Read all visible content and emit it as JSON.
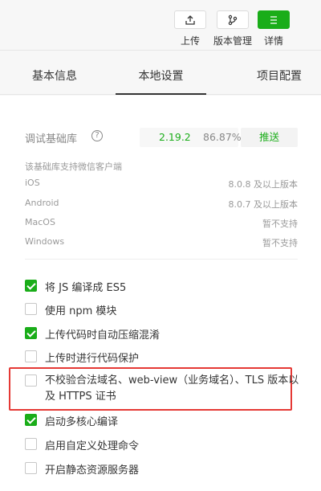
{
  "toolbar": {
    "upload_label": "上传",
    "version_label": "版本管理",
    "detail_label": "详情"
  },
  "tabs": [
    {
      "label": "基本信息"
    },
    {
      "label": "本地设置"
    },
    {
      "label": "项目配置"
    }
  ],
  "library": {
    "label": "调试基础库",
    "help": "?",
    "version": "2.19.2",
    "percent": "86.87%",
    "push_label": "推送"
  },
  "support": {
    "title": "该基础库支持微信客户端",
    "rows": [
      {
        "os": "iOS",
        "req": "8.0.8 及以上版本"
      },
      {
        "os": "Android",
        "req": "8.0.7 及以上版本"
      },
      {
        "os": "MacOS",
        "req": "暂不支持"
      },
      {
        "os": "Windows",
        "req": "暂不支持"
      }
    ]
  },
  "options": [
    {
      "label": "将 JS 编译成 ES5",
      "checked": true
    },
    {
      "label": "使用 npm 模块",
      "checked": false
    },
    {
      "label": "上传代码时自动压缩混淆",
      "checked": true
    },
    {
      "label": "上传时进行代码保护",
      "checked": false
    },
    {
      "label": "不校验合法域名、web-view（业务域名）、TLS 版本以及 HTTPS 证书",
      "checked": false
    },
    {
      "label": "启动多核心编译",
      "checked": true
    },
    {
      "label": "启用自定义处理命令",
      "checked": false
    },
    {
      "label": "开启静态资源服务器",
      "checked": false
    }
  ],
  "colors": {
    "accent": "#1aad19",
    "highlight_border": "#e53935"
  }
}
